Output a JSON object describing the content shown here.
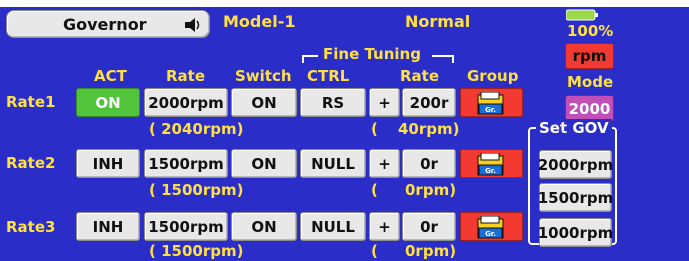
{
  "header": {
    "menu_title": "Governor",
    "model_name": "Model-1",
    "condition": "Normal",
    "battery_percent": "100%"
  },
  "columns": {
    "act": "ACT",
    "rate": "Rate",
    "switch": "Switch",
    "fine_tuning": "Fine Tuning",
    "ctrl": "CTRL",
    "fine_rate": "Rate",
    "group": "Group"
  },
  "group_icon_text": "Gr.",
  "rows": [
    {
      "name": "Rate1",
      "act": "ON",
      "rate": "2000rpm",
      "switch": "ON",
      "ctrl": "RS",
      "sign": "+",
      "fine_rate": "200r",
      "actual_rate": "( 2040rpm)",
      "actual_fine_open": "(",
      "actual_fine": "40rpm)"
    },
    {
      "name": "Rate2",
      "act": "INH",
      "rate": "1500rpm",
      "switch": "ON",
      "ctrl": "NULL",
      "sign": "+",
      "fine_rate": "0r",
      "actual_rate": "( 1500rpm)",
      "actual_fine_open": "(",
      "actual_fine": "0rpm)"
    },
    {
      "name": "Rate3",
      "act": "INH",
      "rate": "1500rpm",
      "switch": "ON",
      "ctrl": "NULL",
      "sign": "+",
      "fine_rate": "0r",
      "actual_rate": "( 1500rpm)",
      "actual_fine_open": "(",
      "actual_fine": "0rpm)"
    }
  ],
  "right_panel": {
    "unit_button": "rpm",
    "mode_label": "Mode",
    "mode_value": "2000",
    "set_gov_label": "Set GOV",
    "set_gov_buttons": [
      "2000rpm",
      "1500rpm",
      "1000rpm"
    ]
  },
  "colors": {
    "background": "#2a2dc8",
    "label_yellow": "#ffe040",
    "act_on_green": "#52c43c",
    "group_red": "#f23a32",
    "mode_purple": "#c24fb8"
  }
}
